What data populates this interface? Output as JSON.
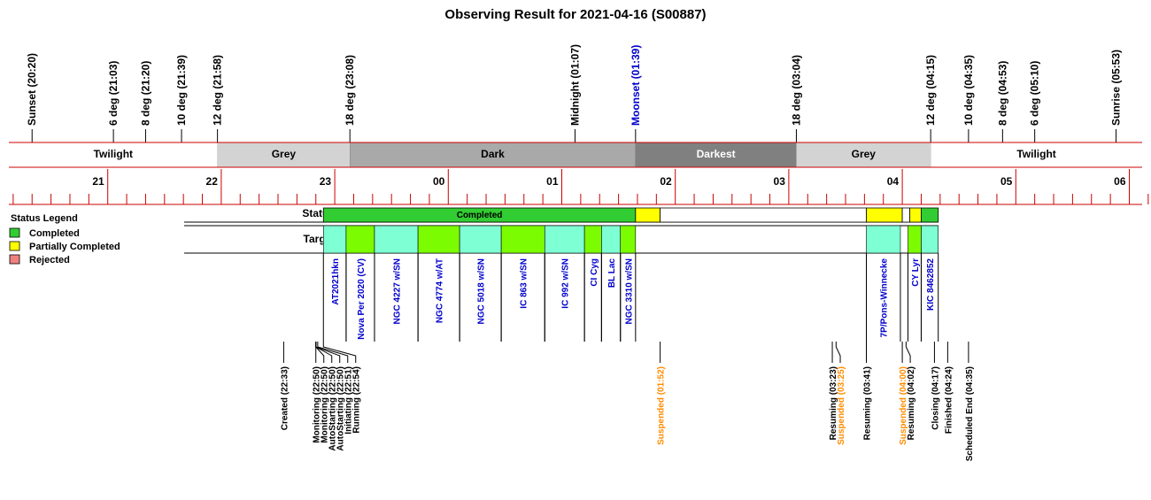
{
  "title": "Observing Result for 2021-04-16 (S00887)",
  "chart_data": {
    "type": "timeline",
    "title": "Observing Result for 2021-04-16 (S00887)",
    "time_axis": {
      "start": "20:05",
      "end": "06:10",
      "tick_labels": [
        "21",
        "22",
        "23",
        "00",
        "01",
        "02",
        "03",
        "04",
        "05",
        "06"
      ]
    },
    "sun_moon_events": [
      {
        "label": "Sunset (20:20)",
        "time": "20:20",
        "color": "#000000"
      },
      {
        "label": "6 deg (21:03)",
        "time": "21:03",
        "color": "#000000"
      },
      {
        "label": "8 deg (21:20)",
        "time": "21:20",
        "color": "#000000"
      },
      {
        "label": "10 deg (21:39)",
        "time": "21:39",
        "color": "#000000"
      },
      {
        "label": "12 deg (21:58)",
        "time": "21:58",
        "color": "#000000"
      },
      {
        "label": "18 deg (23:08)",
        "time": "23:08",
        "color": "#000000"
      },
      {
        "label": "Midnight (01:07)",
        "time": "01:07",
        "color": "#000000"
      },
      {
        "label": "Moonset (01:39)",
        "time": "01:39",
        "color": "#0000cc"
      },
      {
        "label": "18 deg (03:04)",
        "time": "03:04",
        "color": "#000000"
      },
      {
        "label": "12 deg (04:15)",
        "time": "04:15",
        "color": "#000000"
      },
      {
        "label": "10 deg (04:35)",
        "time": "04:35",
        "color": "#000000"
      },
      {
        "label": "8 deg (04:53)",
        "time": "04:53",
        "color": "#000000"
      },
      {
        "label": "6 deg (05:10)",
        "time": "05:10",
        "color": "#000000"
      },
      {
        "label": "Sunrise (05:53)",
        "time": "05:53",
        "color": "#000000"
      }
    ],
    "sky_periods": [
      {
        "label": "Twilight",
        "start": "20:05",
        "end": "21:58",
        "color": "#ffffff",
        "text_color": "#000000"
      },
      {
        "label": "Grey",
        "start": "21:58",
        "end": "23:08",
        "color": "#d3d3d3",
        "text_color": "#000000"
      },
      {
        "label": "Dark",
        "start": "23:08",
        "end": "01:39",
        "color": "#a9a9a9",
        "text_color": "#000000"
      },
      {
        "label": "Darkest",
        "start": "01:39",
        "end": "03:04",
        "color": "#808080",
        "text_color": "#ffffff"
      },
      {
        "label": "Grey",
        "start": "03:04",
        "end": "04:15",
        "color": "#d3d3d3",
        "text_color": "#000000"
      },
      {
        "label": "Twilight",
        "start": "04:15",
        "end": "06:10",
        "color": "#ffffff",
        "text_color": "#000000"
      }
    ],
    "status_row_label": "Status",
    "status_row_start": "21:58",
    "status_segments": [
      {
        "start": "22:54",
        "end": "01:39",
        "status": "completed",
        "text": "Completed"
      },
      {
        "start": "01:39",
        "end": "01:52",
        "status": "partial",
        "text": ""
      },
      {
        "start": "01:52",
        "end": "03:41",
        "status": "none",
        "text": ""
      },
      {
        "start": "03:41",
        "end": "04:00",
        "status": "partial",
        "text": ""
      },
      {
        "start": "04:00",
        "end": "04:04",
        "status": "none",
        "text": ""
      },
      {
        "start": "04:04",
        "end": "04:10",
        "status": "partial",
        "text": ""
      },
      {
        "start": "04:10",
        "end": "04:19",
        "status": "completed",
        "text": ""
      }
    ],
    "targets_row_label": "Targets",
    "targets": [
      {
        "name": "AT2021hkn",
        "start": "22:54",
        "end": "23:06",
        "color": "#7fffd4"
      },
      {
        "name": "Nova Per 2020 (CV)",
        "start": "23:06",
        "end": "23:21",
        "color": "#7cfc00"
      },
      {
        "name": "NGC 4227 w/SN",
        "start": "23:21",
        "end": "23:44",
        "color": "#7fffd4"
      },
      {
        "name": "NGC 4774 w/AT",
        "start": "23:44",
        "end": "00:06",
        "color": "#7cfc00"
      },
      {
        "name": "NGC 5018 w/SN",
        "start": "00:06",
        "end": "00:28",
        "color": "#7fffd4"
      },
      {
        "name": "IC 863 w/SN",
        "start": "00:28",
        "end": "00:51",
        "color": "#7cfc00"
      },
      {
        "name": "IC 992 w/SN",
        "start": "00:51",
        "end": "01:12",
        "color": "#7fffd4"
      },
      {
        "name": "CI Cyg",
        "start": "01:12",
        "end": "01:21",
        "color": "#7cfc00"
      },
      {
        "name": "BL Lac",
        "start": "01:21",
        "end": "01:31",
        "color": "#7fffd4"
      },
      {
        "name": "NGC 3310 w/SN",
        "start": "01:31",
        "end": "01:39",
        "color": "#7cfc00"
      },
      {
        "name": "7P/Pons-Winnecke",
        "start": "03:41",
        "end": "03:59",
        "color": "#7fffd4"
      },
      {
        "name": "CY Lyr",
        "start": "04:03",
        "end": "04:10",
        "color": "#7cfc00"
      },
      {
        "name": "KIC 8462852",
        "start": "04:10",
        "end": "04:19",
        "color": "#7fffd4"
      }
    ],
    "legend": {
      "title": "Status Legend",
      "placement": "left",
      "items": [
        {
          "label": "Completed",
          "color": "#32cd32"
        },
        {
          "label": "Partially Completed",
          "color": "#ffff00"
        },
        {
          "label": "Rejected",
          "color": "#f08080"
        }
      ]
    },
    "log_events": [
      {
        "label": "Created (22:33)",
        "time": "22:33",
        "color": "#000000"
      },
      {
        "label": "Monitoring (22:50)",
        "time": "22:50",
        "color": "#000000"
      },
      {
        "label": "Monitoring (22:50)",
        "time": "22:50",
        "color": "#000000"
      },
      {
        "label": "AutoStarting (22:50)",
        "time": "22:50",
        "color": "#000000"
      },
      {
        "label": "AutoStarting (22:50)",
        "time": "22:50",
        "color": "#000000"
      },
      {
        "label": "Initiating (22:51)",
        "time": "22:51",
        "color": "#000000"
      },
      {
        "label": "Running (22:54)",
        "time": "22:54",
        "color": "#000000"
      },
      {
        "label": "Suspended (01:52)",
        "time": "01:52",
        "color": "#ff8c00"
      },
      {
        "label": "Resuming (03:23)",
        "time": "03:23",
        "color": "#000000"
      },
      {
        "label": "Suspended (03:25)",
        "time": "03:25",
        "color": "#ff8c00"
      },
      {
        "label": "Resuming (03:41)",
        "time": "03:41",
        "color": "#000000"
      },
      {
        "label": "Suspended (04:00)",
        "time": "04:00",
        "color": "#ff8c00"
      },
      {
        "label": "Resuming (04:02)",
        "time": "04:02",
        "color": "#000000"
      },
      {
        "label": "Closing (04:17)",
        "time": "04:17",
        "color": "#000000"
      },
      {
        "label": "Finished (04:24)",
        "time": "04:24",
        "color": "#000000"
      },
      {
        "label": "Scheduled End (04:35)",
        "time": "04:35",
        "color": "#000000"
      }
    ]
  },
  "colors": {
    "axis_red": "#cc0000",
    "completed": "#32cd32",
    "partial": "#ffff00",
    "rejected": "#f08080",
    "target_label": "#0000cc"
  }
}
